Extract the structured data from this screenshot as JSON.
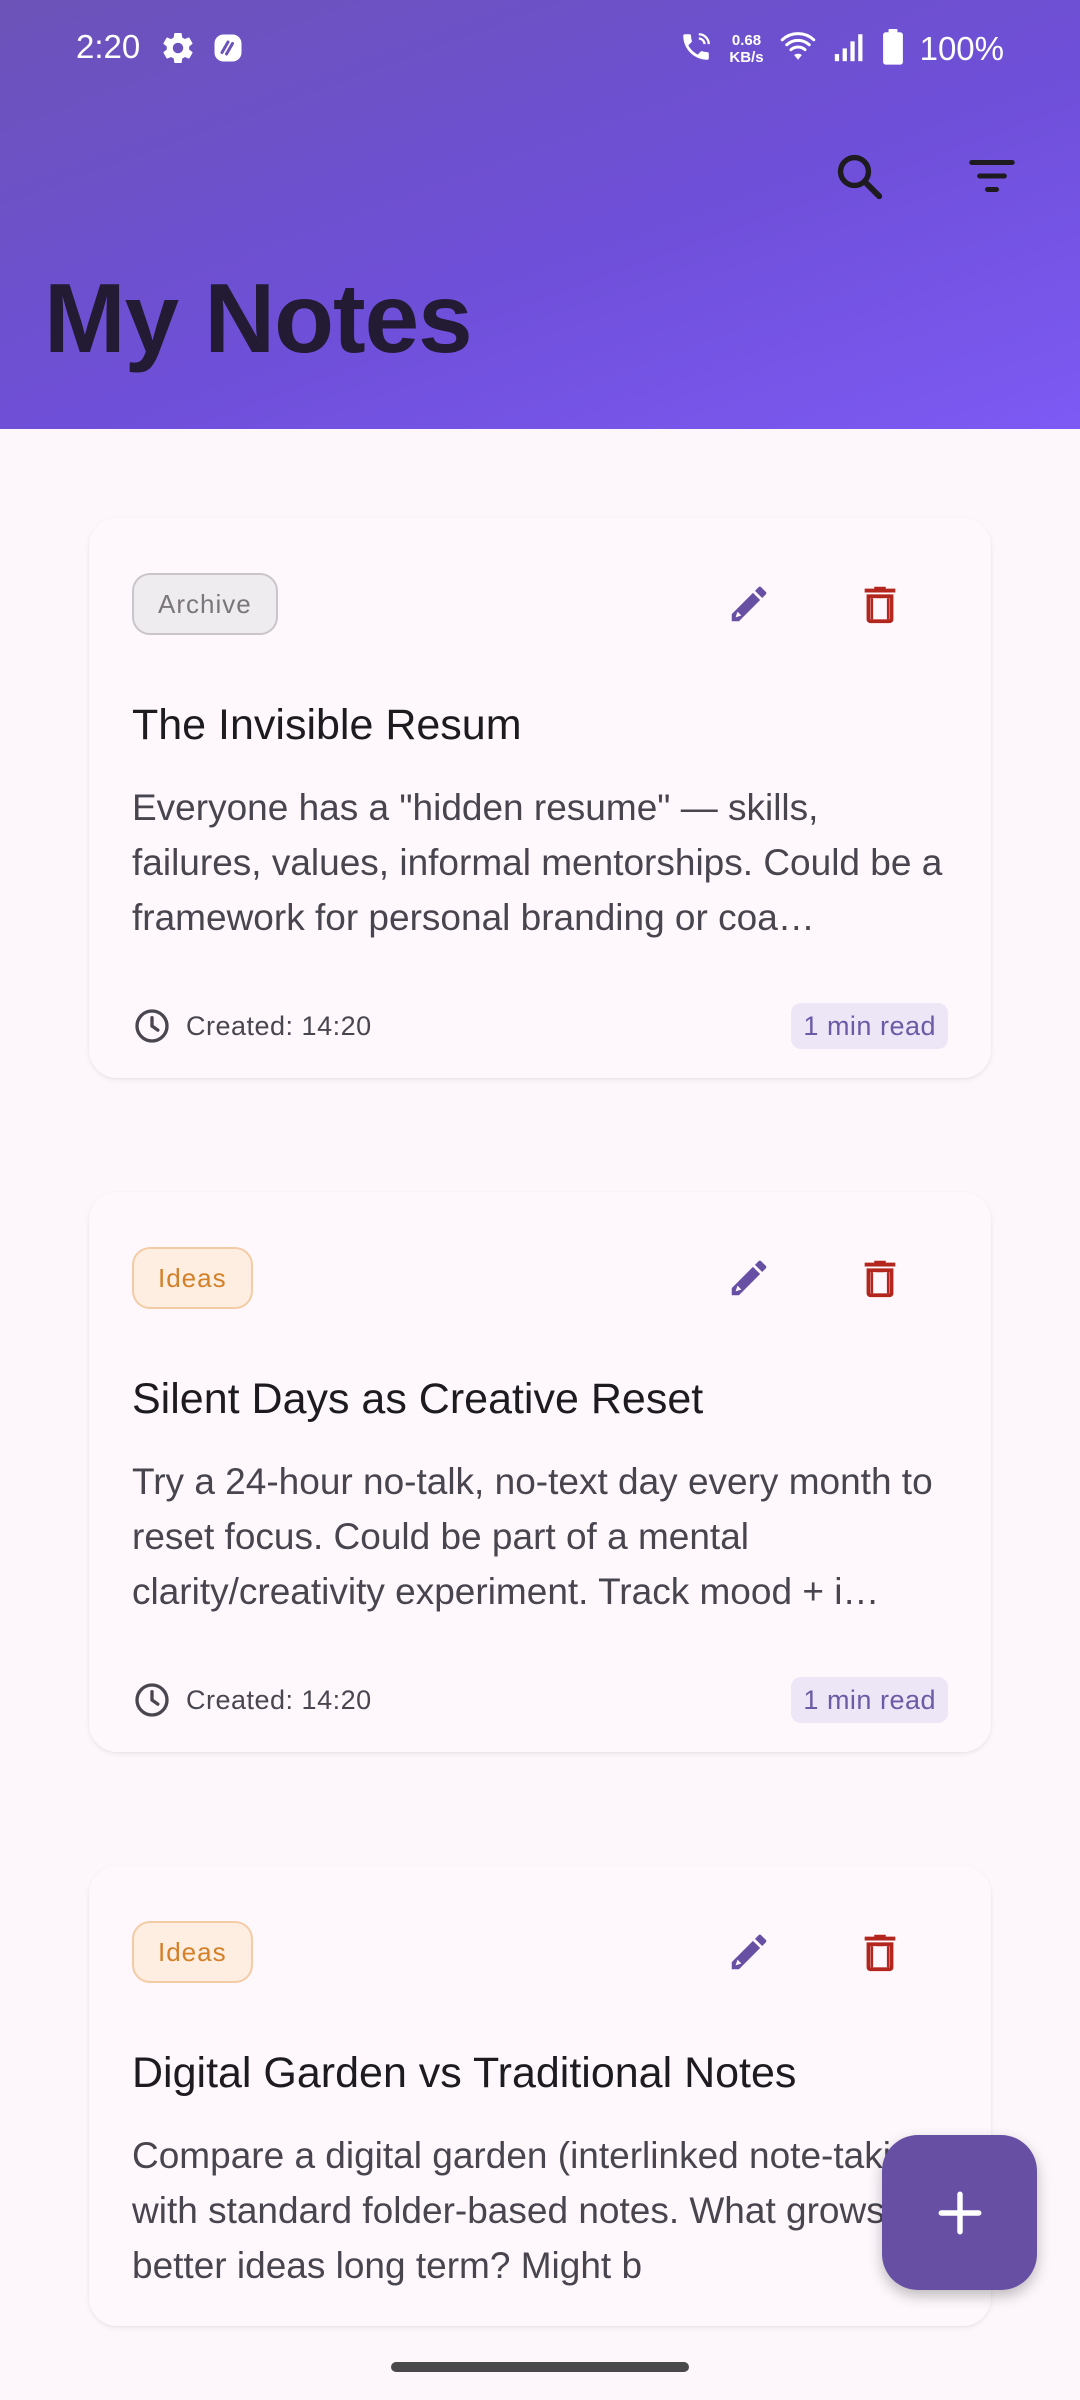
{
  "status_bar": {
    "time": "2:20",
    "net_speed_value": "0.68",
    "net_speed_unit": "KB/s",
    "battery": "100%"
  },
  "header": {
    "title": "My Notes",
    "background_colors": [
      "#6b53b8",
      "#7d5af4"
    ]
  },
  "notes": [
    {
      "category": "Archive",
      "title": "The Invisible Resum",
      "body": "Everyone has a \"hidden resume\" — skills, failures, values, informal mentorships. Could be a framework for personal branding or coa…",
      "created": "Created: 14:20",
      "read_time": "1 min read"
    },
    {
      "category": "Ideas",
      "title": "Silent Days as Creative Reset",
      "body": "Try a 24-hour no-talk, no-text day every month to reset focus. Could be part of a mental clarity/creativity experiment. Track mood + i…",
      "created": "Created: 14:20",
      "read_time": "1 min read"
    },
    {
      "category": "Ideas",
      "title": "Digital Garden vs Traditional Notes",
      "body": "Compare a digital garden (interlinked note-taking) with standard folder-based notes. What grows better ideas long term? Might b"
    }
  ],
  "colors": {
    "accent": "#6750a4",
    "delete": "#b3261e",
    "edit": "#6750a4"
  }
}
